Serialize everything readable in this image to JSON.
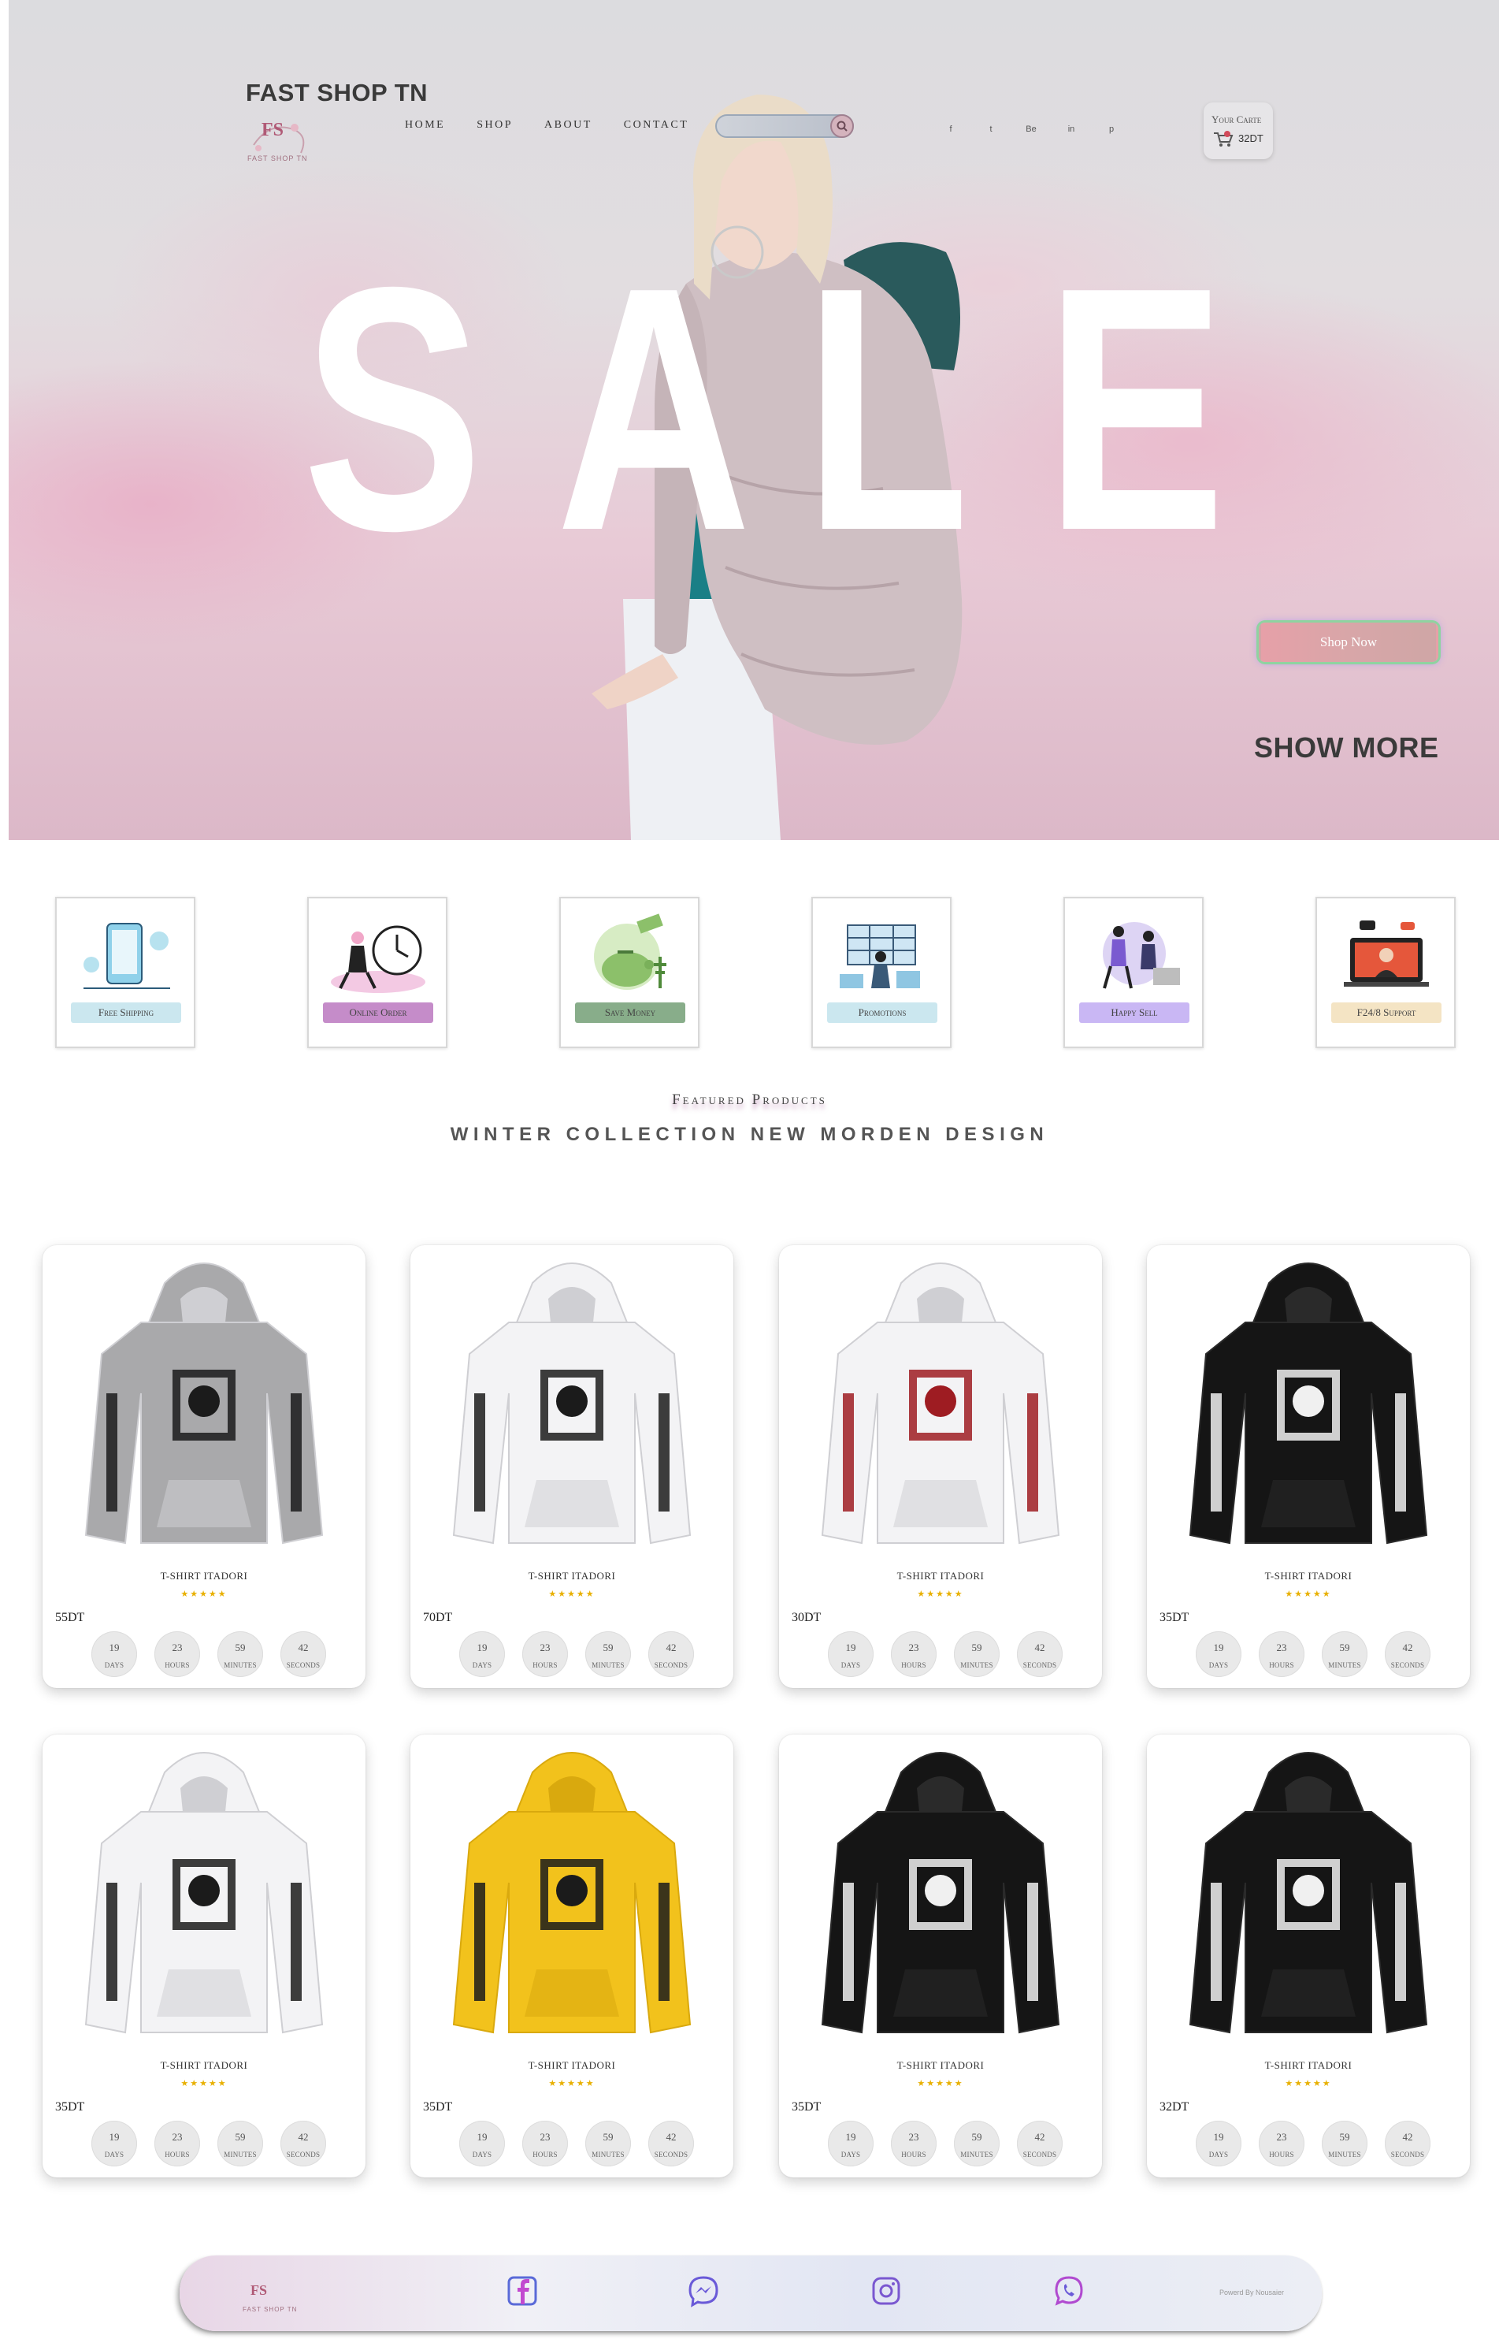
{
  "brand": {
    "name": "FAST SHOP TN",
    "logo_text": "FS",
    "logo_sub": "FAST SHOP TN"
  },
  "nav": [
    "HOME",
    "SHOP",
    "ABOUT",
    "CONTACT"
  ],
  "search": {
    "placeholder": ""
  },
  "social_top": [
    "facebook-icon",
    "twitter-icon",
    "behance-icon",
    "linkedin-icon",
    "pinterest-icon"
  ],
  "social_top_glyphs": [
    "f",
    "t",
    "Be",
    "in",
    "p"
  ],
  "cart": {
    "title": "Your Carte",
    "total": "32DT"
  },
  "hero": {
    "sale_letters": [
      "S",
      "A",
      "L",
      "E"
    ],
    "shop_now": "Shop Now",
    "show_more": "SHOW MORE"
  },
  "features": [
    {
      "label": "Free Shipping",
      "color": "#cbe7ef",
      "icon": "delivery-phone-icon"
    },
    {
      "label": "Online Order",
      "color": "#c58cc9",
      "icon": "online-order-clock-icon"
    },
    {
      "label": "Save Money",
      "color": "#88ad8a",
      "icon": "piggy-bank-icon"
    },
    {
      "label": "Promotions",
      "color": "#cbe7ef",
      "icon": "promotions-icon"
    },
    {
      "label": "Happy Sell",
      "color": "#c9b7f4",
      "icon": "happy-sell-icon"
    },
    {
      "label": "F24/8 Support",
      "color": "#f4e4c4",
      "icon": "support-laptop-icon"
    }
  ],
  "featured": {
    "subtitle": "Featured Products",
    "title": "WINTER COLLECTION NEW MORDEN DESIGN"
  },
  "timer_labels": [
    "DAYS",
    "HOURS",
    "MINUTES",
    "SECONDS"
  ],
  "products": [
    {
      "name": "T-SHIRT ITADORI",
      "price": "55DT",
      "rating": 5,
      "stars": "★★★★★",
      "color": "#a9a9ab",
      "print": "#1b1b1b",
      "timer": [
        "19",
        "23",
        "59",
        "42"
      ]
    },
    {
      "name": "T-SHIRT ITADORI",
      "price": "70DT",
      "rating": 5,
      "stars": "★★★★★",
      "color": "#f3f3f5",
      "print": "#1b1b1b",
      "timer": [
        "19",
        "23",
        "59",
        "42"
      ]
    },
    {
      "name": "T-SHIRT ITADORI",
      "price": "30DT",
      "rating": 5,
      "stars": "★★★★★",
      "color": "#f3f3f5",
      "print": "#9e1c22",
      "timer": [
        "19",
        "23",
        "59",
        "42"
      ]
    },
    {
      "name": "T-SHIRT ITADORI",
      "price": "35DT",
      "rating": 5,
      "stars": "★★★★★",
      "color": "#151515",
      "print": "#f0f0f0",
      "timer": [
        "19",
        "23",
        "59",
        "42"
      ]
    },
    {
      "name": "T-SHIRT ITADORI",
      "price": "35DT",
      "rating": 5,
      "stars": "★★★★★",
      "color": "#f3f3f5",
      "print": "#1b1b1b",
      "timer": [
        "19",
        "23",
        "59",
        "42"
      ]
    },
    {
      "name": "T-SHIRT ITADORI",
      "price": "35DT",
      "rating": 5,
      "stars": "★★★★★",
      "color": "#f2c21c",
      "print": "#1b1b1b",
      "timer": [
        "19",
        "23",
        "59",
        "42"
      ]
    },
    {
      "name": "T-SHIRT ITADORI",
      "price": "35DT",
      "rating": 5,
      "stars": "★★★★★",
      "color": "#151515",
      "print": "#f0f0f0",
      "timer": [
        "19",
        "23",
        "59",
        "42"
      ]
    },
    {
      "name": "T-SHIRT ITADORI",
      "price": "32DT",
      "rating": 5,
      "stars": "★★★★★",
      "color": "#151515",
      "print": "#f0f0f0",
      "timer": [
        "19",
        "23",
        "59",
        "42"
      ]
    }
  ],
  "footer": {
    "logo_text": "FS",
    "logo_sub": "FAST SHOP TN",
    "icons": [
      "facebook-icon",
      "messenger-icon",
      "instagram-icon",
      "whatsapp-icon"
    ],
    "powered": "Powerd By Nousaier"
  }
}
